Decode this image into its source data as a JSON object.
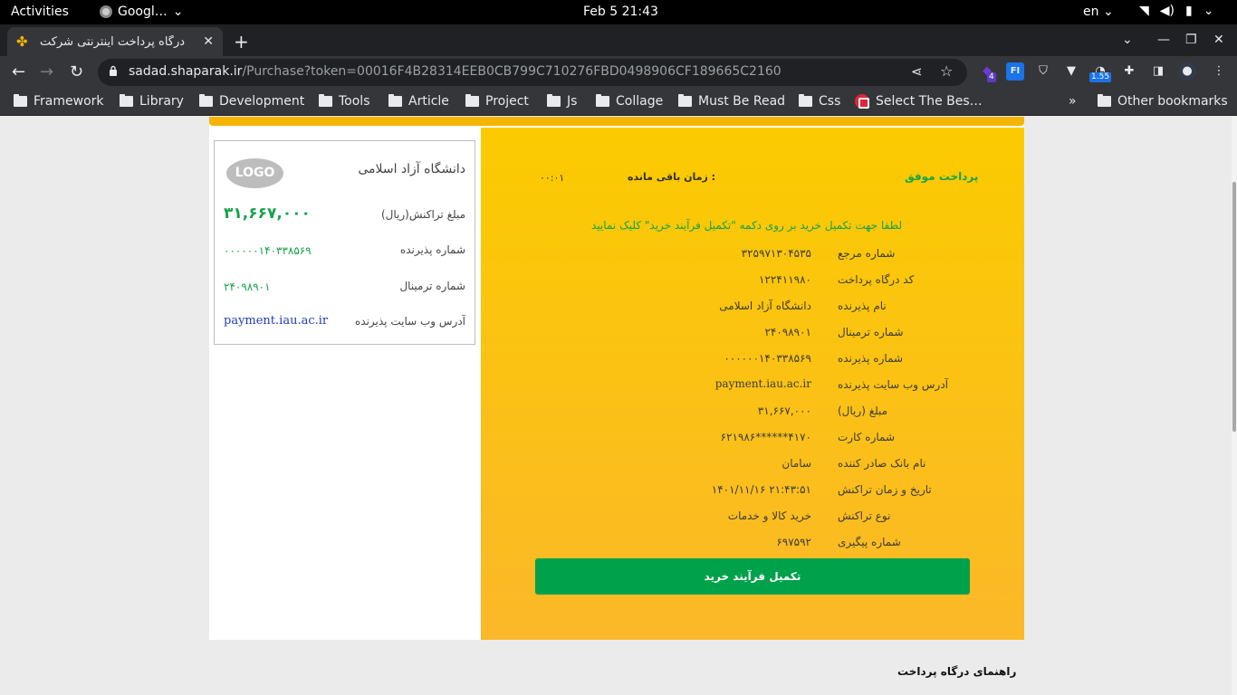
{
  "system_bar": {
    "activities": "Activities",
    "app_name": "Googl…",
    "clock": "Feb 5  21:43",
    "lang": "en"
  },
  "browser": {
    "tab_title": "درگاه پرداخت اینترنتی شرکت",
    "url_host": "sadad.shaparak.ir",
    "url_path": "/Purchase?token=00016F4B28314EEB0CB799C710276FBD0498906CF189665C2160",
    "ext_badge_1": "4",
    "ext_badge_2": "1.55",
    "ext_label_fi": "FI",
    "bookmarks": [
      "Framework",
      "Library",
      "Development",
      "Tools",
      "Article",
      "Project",
      "Js",
      "Collage",
      "Must Be Read",
      "Css",
      "Select The Bes…"
    ],
    "more_bookmarks": "»",
    "other_bookmarks": "Other bookmarks"
  },
  "receipt": {
    "status": "پرداخت موفق",
    "remaining_label": "زمان باقی مانده :",
    "timer": "۰۰:۰۱",
    "instruction": "لطفا جهت تکمیل خرید بر روی دکمه \"تکمیل فرآیند خرید\" کلیک نمایید",
    "rows": [
      {
        "label": "شماره مرجع",
        "value": "۳۲۵۹۷۱۳۰۴۵۳۵"
      },
      {
        "label": "کد درگاه پرداخت",
        "value": "۱۲۲۴۱۱۹۸۰"
      },
      {
        "label": "نام پذیرنده",
        "value": "دانشگاه آزاد اسلامی"
      },
      {
        "label": "شماره ترمینال",
        "value": "۲۴۰۹۸۹۰۱"
      },
      {
        "label": "شماره پذیرنده",
        "value": "۰۰۰۰۰۰۱۴۰۳۳۸۵۶۹"
      },
      {
        "label": "آدرس وب سایت پذیرنده",
        "value": "payment.iau.ac.ir"
      },
      {
        "label": "مبلغ (ریال)",
        "value": "۳۱,۶۶۷,۰۰۰"
      },
      {
        "label": "شماره کارت",
        "value": "۶۲۱۹۸۶******۴۱۷۰"
      },
      {
        "label": "نام بانک صادر کننده",
        "value": "سامان"
      },
      {
        "label": "تاریخ و زمان تراکنش",
        "value": "۱۴۰۱/۱۱/۱۶  ۲۱:۴۳:۵۱"
      },
      {
        "label": "نوع تراکنش",
        "value": "خرید کالا و خدمات"
      },
      {
        "label": "شماره پیگیری",
        "value": "۶۹۷۵۹۲"
      }
    ],
    "complete_button": "تکمیل فرآیند خرید"
  },
  "summary": {
    "logo": "LOGO",
    "merchant_name": "دانشگاه آزاد اسلامی",
    "amount_label": "مبلغ تراکنش(ریال)",
    "amount_value": "۳۱,۶۶۷,۰۰۰",
    "merchant_id_label": "شماره پذیرنده",
    "merchant_id_value": "۰۰۰۰۰۰۱۴۰۳۳۸۵۶۹",
    "terminal_label": "شماره ترمینال",
    "terminal_value": "۲۴۰۹۸۹۰۱",
    "website_label": "آدرس وب سایت پذیرنده",
    "website_value": "payment.iau.ac.ir"
  },
  "guide_title": "راهنمای درگاه پرداخت",
  "colors": {
    "accent_yellow": "#fbcb00",
    "success_green": "#00a14b",
    "link_blue": "#1f3fb4"
  }
}
